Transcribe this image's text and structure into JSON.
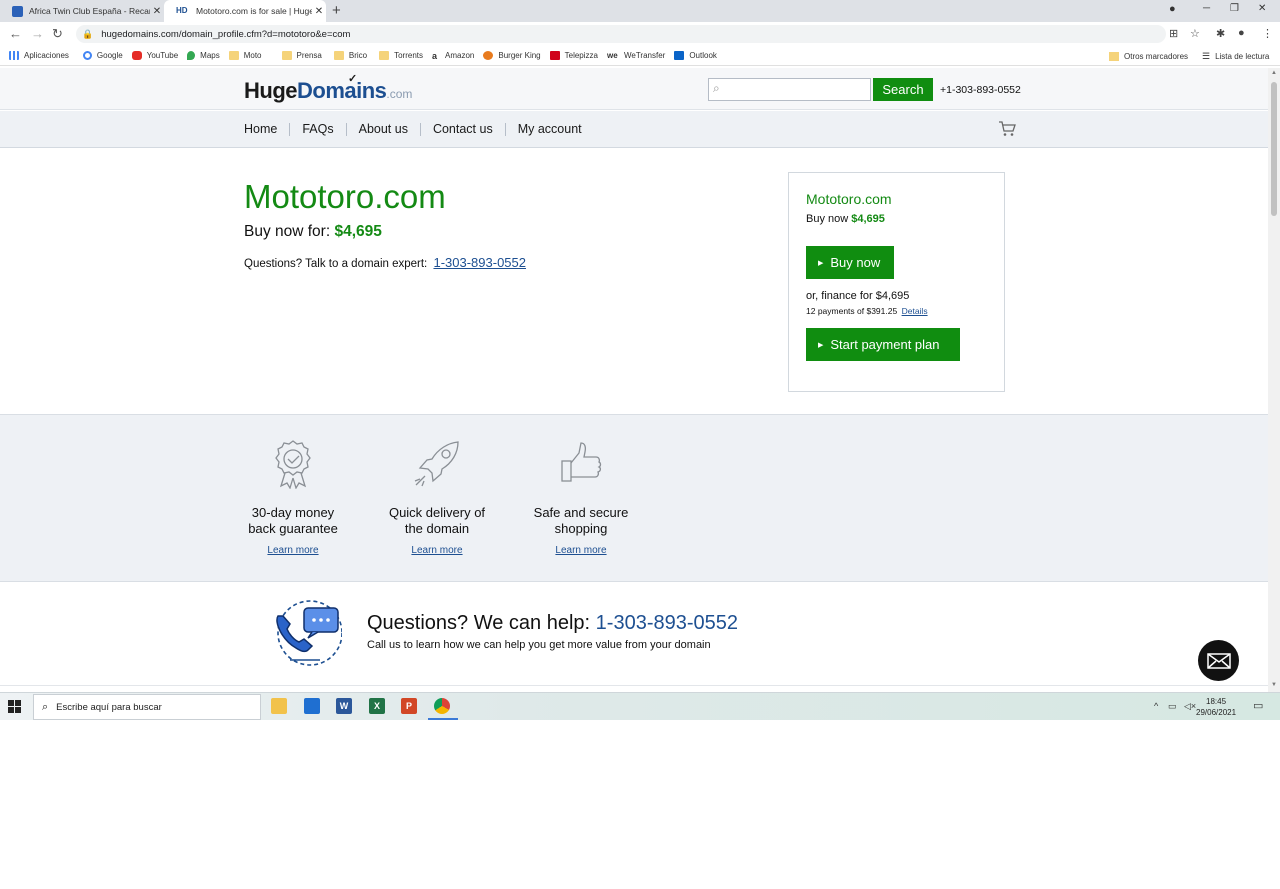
{
  "browser": {
    "tabs": [
      {
        "title": "Africa Twin Club España - Recam",
        "active": false
      },
      {
        "title": "Mototoro.com is for sale | HugeD",
        "active": true
      }
    ],
    "url": "hugedomains.com/domain_profile.cfm?d=mototoro&e=com",
    "bookmarks": [
      "Aplicaciones",
      "Google",
      "YouTube",
      "Maps",
      "Moto",
      "Prensa",
      "Brico",
      "Torrents",
      "Amazon",
      "Burger King",
      "Telepizza",
      "WeTransfer",
      "Outlook"
    ],
    "bookmarks_right": [
      "Otros marcadores",
      "Lista de lectura"
    ]
  },
  "header": {
    "logo_huge": "Huge",
    "logo_domains": "Domains",
    "logo_com": ".com",
    "search_button": "Search",
    "search_placeholder": "",
    "phone": "+1-303-893-0552"
  },
  "nav": {
    "items": [
      "Home",
      "FAQs",
      "About us",
      "Contact us",
      "My account"
    ]
  },
  "main": {
    "domain": "Mototoro.com",
    "buy_label": "Buy now for:",
    "price": "$4,695",
    "question": "Questions? Talk to a domain expert:",
    "phone": "1-303-893-0552"
  },
  "card": {
    "domain": "Mototoro.com",
    "buy_label": "Buy now",
    "price": "$4,695",
    "buy_button": "Buy now",
    "finance": "or, finance for $4,695",
    "payments": "12 payments of $391.25",
    "details": "Details",
    "plan_button": "Start payment plan"
  },
  "features": [
    {
      "icon": "award-ribbon-icon",
      "line1": "30-day money",
      "line2": "back guarantee",
      "link": "Learn more"
    },
    {
      "icon": "rocket-icon",
      "line1": "Quick delivery of",
      "line2": "the domain",
      "link": "Learn more"
    },
    {
      "icon": "thumbs-up-icon",
      "line1": "Safe and secure",
      "line2": "shopping",
      "link": "Learn more"
    }
  ],
  "help": {
    "title": "Questions? We can help:",
    "phone": "1-303-893-0552",
    "subtitle": "Call us to learn how we can help you get more value from your domain"
  },
  "taskbar": {
    "search_text": "Escribe aquí para buscar",
    "time": "18:45",
    "date": "29/06/2021"
  },
  "colors": {
    "green": "#108d10",
    "blue": "#1d4f91",
    "light_bg": "#eef1f5"
  }
}
